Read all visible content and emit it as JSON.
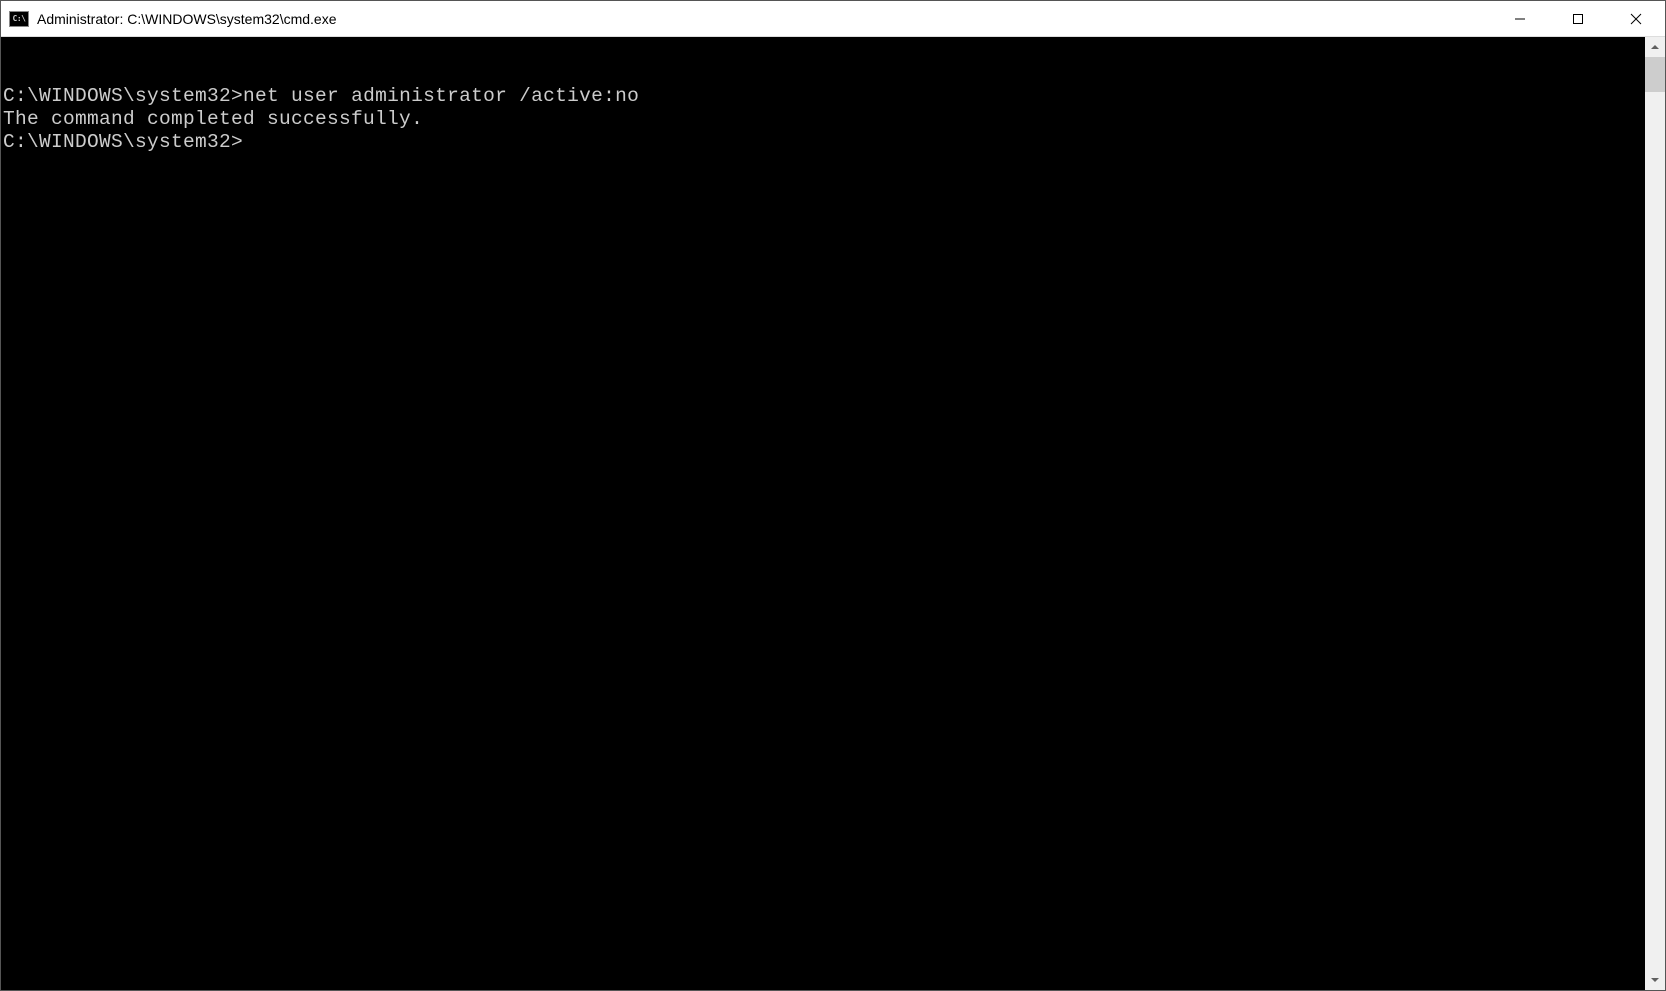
{
  "window": {
    "title": "Administrator: C:\\WINDOWS\\system32\\cmd.exe",
    "icon_text": "C:\\"
  },
  "terminal": {
    "line1_prompt": "C:\\WINDOWS\\system32>",
    "line1_command": "net user administrator /active:no",
    "line2": "The command completed successfully.",
    "blank": "",
    "line3_prompt": "C:\\WINDOWS\\system32>"
  }
}
